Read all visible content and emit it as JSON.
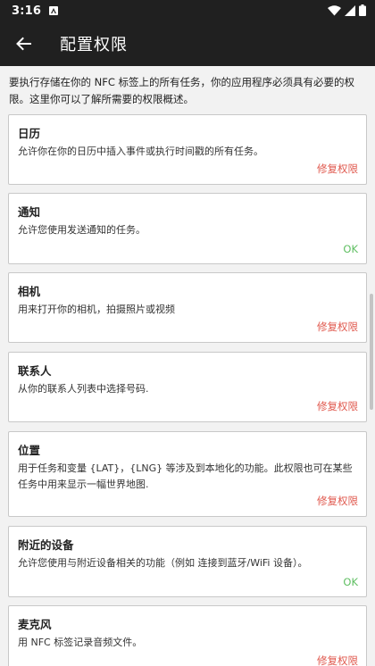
{
  "status_bar": {
    "time": "3:16"
  },
  "app_bar": {
    "title": "配置权限"
  },
  "intro": "要执行存储在你的 NFC 标签上的所有任务，你的应用程序必须具有必要的权限。这里你可以了解所需要的权限概述。",
  "permissions": [
    {
      "title": "日历",
      "description": "允许你在你的日历中插入事件或执行时间戳的所有任务。",
      "action": "修复权限",
      "status": "fix"
    },
    {
      "title": "通知",
      "description": "允许您使用发送通知的任务。",
      "action": "OK",
      "status": "ok"
    },
    {
      "title": "相机",
      "description": "用来打开你的相机，拍摄照片或视频",
      "action": "修复权限",
      "status": "fix"
    },
    {
      "title": "联系人",
      "description": "从你的联系人列表中选择号码.",
      "action": "修复权限",
      "status": "fix"
    },
    {
      "title": "位置",
      "description": "用于任务和变量 {LAT}，{LNG} 等涉及到本地化的功能。此权限也可在某些任务中用来显示一幅世界地图.",
      "action": "修复权限",
      "status": "fix"
    },
    {
      "title": "附近的设备",
      "description": "允许您使用与附近设备相关的功能（例如 连接到蓝牙/WiFi 设备）。",
      "action": "OK",
      "status": "ok"
    },
    {
      "title": "麦克风",
      "description": "用 NFC 标签记录音频文件。",
      "action": "修复权限",
      "status": "fix"
    }
  ],
  "colors": {
    "bar": "#202020",
    "fix": "#e05a4f",
    "ok": "#5fbf62"
  }
}
